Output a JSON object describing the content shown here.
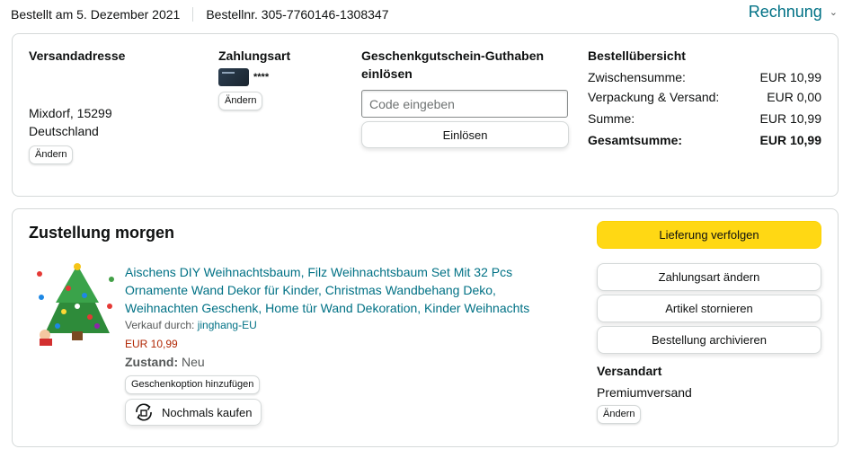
{
  "header": {
    "order_date": "Bestellt am 5. Dezember 2021",
    "order_number": "Bestellnr. 305-7760146-1308347",
    "invoice_label": "Rechnung",
    "invoice_icon": "chevron-down-icon"
  },
  "shipping_address": {
    "heading": "Versandadresse",
    "line1": "Mixdorf, 15299",
    "line2": "Deutschland",
    "change_label": "Ändern"
  },
  "payment": {
    "heading": "Zahlungsart",
    "card_mask": "****",
    "card_icon": "credit-card-icon",
    "change_label": "Ändern"
  },
  "gift_card": {
    "heading_line1": "Geschenkgutschein-Guthaben",
    "heading_line2": "einlösen",
    "placeholder": "Code eingeben",
    "redeem_label": "Einlösen"
  },
  "summary": {
    "heading": "Bestellübersicht",
    "rows": [
      {
        "label": "Zwischensumme:",
        "value": "EUR 10,99"
      },
      {
        "label": "Verpackung & Versand:",
        "value": "EUR 0,00"
      },
      {
        "label": "Summe:",
        "value": "EUR 10,99"
      }
    ],
    "total_label": "Gesamtsumme:",
    "total_value": "EUR 10,99"
  },
  "shipment": {
    "title": "Zustellung morgen",
    "product": {
      "title": "Aischens DIY Weihnachtsbaum, Filz Weihnachtsbaum Set Mit 32 Pcs Ornamente Wand Dekor für Kinder, Christmas Wandbehang Deko, Weihnachten Geschenk, Home tür Wand Dekoration, Kinder Weihnachts",
      "seller_prefix": "Verkauf durch: ",
      "seller": "jinghang-EU",
      "price": "EUR 10,99",
      "condition_label": "Zustand:",
      "condition_value": "Neu",
      "gift_option_label": "Geschenkoption hinzufügen",
      "buy_again_label": "Nochmals kaufen",
      "buy_again_icon": "buy-again-icon",
      "image_icon": "christmas-tree-icon"
    },
    "actions": {
      "track": "Lieferung verfolgen",
      "change_payment": "Zahlungsart ändern",
      "cancel": "Artikel stornieren",
      "archive": "Bestellung archivieren"
    },
    "shipping_method": {
      "heading": "Versandart",
      "value": "Premiumversand",
      "change_label": "Ändern"
    }
  },
  "colors": {
    "link": "#007185",
    "price": "#b12704",
    "primary_button": "#ffd814",
    "border": "#d5d9d9"
  }
}
